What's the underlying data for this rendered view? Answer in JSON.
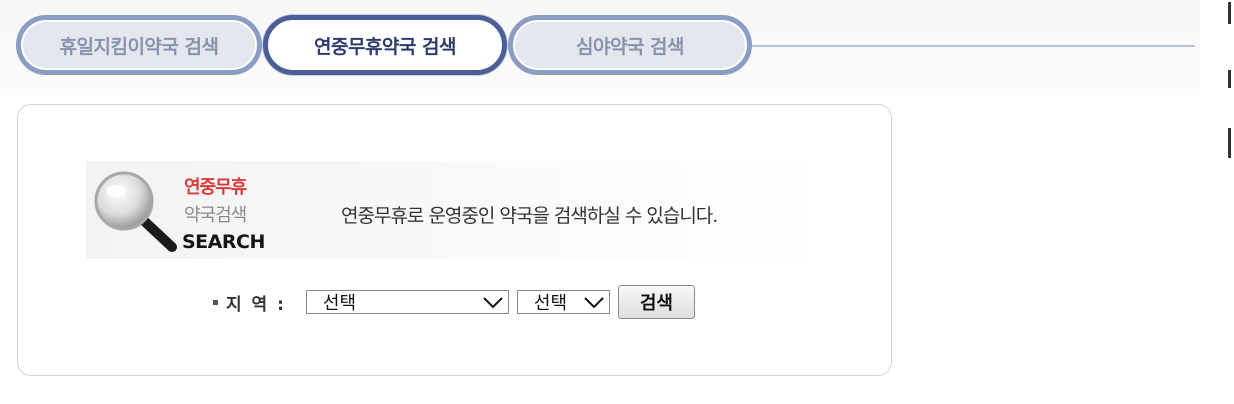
{
  "tabs": [
    {
      "label": "휴일지킴이약국 검색",
      "active": false
    },
    {
      "label": "연중무휴약국 검색",
      "active": true
    },
    {
      "label": "심야약국 검색",
      "active": false
    }
  ],
  "banner": {
    "line1": "연중무휴",
    "line2": "약국검색",
    "line3": "SEARCH",
    "description": "연중무휴로 운영중인 약국을 검색하실 수 있습니다."
  },
  "search": {
    "region_label": "지 역 :",
    "select1_value": "선택",
    "select2_value": "선택",
    "button_label": "검색"
  },
  "colors": {
    "accent": "#4b5e96",
    "highlight_red": "#d93b3b"
  }
}
